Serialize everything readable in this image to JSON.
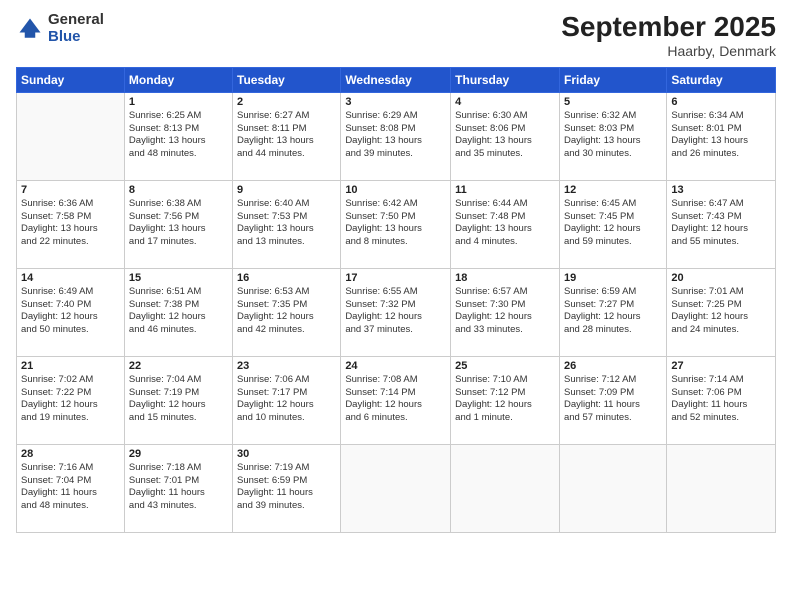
{
  "header": {
    "logo_general": "General",
    "logo_blue": "Blue",
    "month_title": "September 2025",
    "location": "Haarby, Denmark"
  },
  "weekdays": [
    "Sunday",
    "Monday",
    "Tuesday",
    "Wednesday",
    "Thursday",
    "Friday",
    "Saturday"
  ],
  "weeks": [
    [
      {
        "day": "",
        "info": ""
      },
      {
        "day": "1",
        "info": "Sunrise: 6:25 AM\nSunset: 8:13 PM\nDaylight: 13 hours\nand 48 minutes."
      },
      {
        "day": "2",
        "info": "Sunrise: 6:27 AM\nSunset: 8:11 PM\nDaylight: 13 hours\nand 44 minutes."
      },
      {
        "day": "3",
        "info": "Sunrise: 6:29 AM\nSunset: 8:08 PM\nDaylight: 13 hours\nand 39 minutes."
      },
      {
        "day": "4",
        "info": "Sunrise: 6:30 AM\nSunset: 8:06 PM\nDaylight: 13 hours\nand 35 minutes."
      },
      {
        "day": "5",
        "info": "Sunrise: 6:32 AM\nSunset: 8:03 PM\nDaylight: 13 hours\nand 30 minutes."
      },
      {
        "day": "6",
        "info": "Sunrise: 6:34 AM\nSunset: 8:01 PM\nDaylight: 13 hours\nand 26 minutes."
      }
    ],
    [
      {
        "day": "7",
        "info": "Sunrise: 6:36 AM\nSunset: 7:58 PM\nDaylight: 13 hours\nand 22 minutes."
      },
      {
        "day": "8",
        "info": "Sunrise: 6:38 AM\nSunset: 7:56 PM\nDaylight: 13 hours\nand 17 minutes."
      },
      {
        "day": "9",
        "info": "Sunrise: 6:40 AM\nSunset: 7:53 PM\nDaylight: 13 hours\nand 13 minutes."
      },
      {
        "day": "10",
        "info": "Sunrise: 6:42 AM\nSunset: 7:50 PM\nDaylight: 13 hours\nand 8 minutes."
      },
      {
        "day": "11",
        "info": "Sunrise: 6:44 AM\nSunset: 7:48 PM\nDaylight: 13 hours\nand 4 minutes."
      },
      {
        "day": "12",
        "info": "Sunrise: 6:45 AM\nSunset: 7:45 PM\nDaylight: 12 hours\nand 59 minutes."
      },
      {
        "day": "13",
        "info": "Sunrise: 6:47 AM\nSunset: 7:43 PM\nDaylight: 12 hours\nand 55 minutes."
      }
    ],
    [
      {
        "day": "14",
        "info": "Sunrise: 6:49 AM\nSunset: 7:40 PM\nDaylight: 12 hours\nand 50 minutes."
      },
      {
        "day": "15",
        "info": "Sunrise: 6:51 AM\nSunset: 7:38 PM\nDaylight: 12 hours\nand 46 minutes."
      },
      {
        "day": "16",
        "info": "Sunrise: 6:53 AM\nSunset: 7:35 PM\nDaylight: 12 hours\nand 42 minutes."
      },
      {
        "day": "17",
        "info": "Sunrise: 6:55 AM\nSunset: 7:32 PM\nDaylight: 12 hours\nand 37 minutes."
      },
      {
        "day": "18",
        "info": "Sunrise: 6:57 AM\nSunset: 7:30 PM\nDaylight: 12 hours\nand 33 minutes."
      },
      {
        "day": "19",
        "info": "Sunrise: 6:59 AM\nSunset: 7:27 PM\nDaylight: 12 hours\nand 28 minutes."
      },
      {
        "day": "20",
        "info": "Sunrise: 7:01 AM\nSunset: 7:25 PM\nDaylight: 12 hours\nand 24 minutes."
      }
    ],
    [
      {
        "day": "21",
        "info": "Sunrise: 7:02 AM\nSunset: 7:22 PM\nDaylight: 12 hours\nand 19 minutes."
      },
      {
        "day": "22",
        "info": "Sunrise: 7:04 AM\nSunset: 7:19 PM\nDaylight: 12 hours\nand 15 minutes."
      },
      {
        "day": "23",
        "info": "Sunrise: 7:06 AM\nSunset: 7:17 PM\nDaylight: 12 hours\nand 10 minutes."
      },
      {
        "day": "24",
        "info": "Sunrise: 7:08 AM\nSunset: 7:14 PM\nDaylight: 12 hours\nand 6 minutes."
      },
      {
        "day": "25",
        "info": "Sunrise: 7:10 AM\nSunset: 7:12 PM\nDaylight: 12 hours\nand 1 minute."
      },
      {
        "day": "26",
        "info": "Sunrise: 7:12 AM\nSunset: 7:09 PM\nDaylight: 11 hours\nand 57 minutes."
      },
      {
        "day": "27",
        "info": "Sunrise: 7:14 AM\nSunset: 7:06 PM\nDaylight: 11 hours\nand 52 minutes."
      }
    ],
    [
      {
        "day": "28",
        "info": "Sunrise: 7:16 AM\nSunset: 7:04 PM\nDaylight: 11 hours\nand 48 minutes."
      },
      {
        "day": "29",
        "info": "Sunrise: 7:18 AM\nSunset: 7:01 PM\nDaylight: 11 hours\nand 43 minutes."
      },
      {
        "day": "30",
        "info": "Sunrise: 7:19 AM\nSunset: 6:59 PM\nDaylight: 11 hours\nand 39 minutes."
      },
      {
        "day": "",
        "info": ""
      },
      {
        "day": "",
        "info": ""
      },
      {
        "day": "",
        "info": ""
      },
      {
        "day": "",
        "info": ""
      }
    ]
  ]
}
